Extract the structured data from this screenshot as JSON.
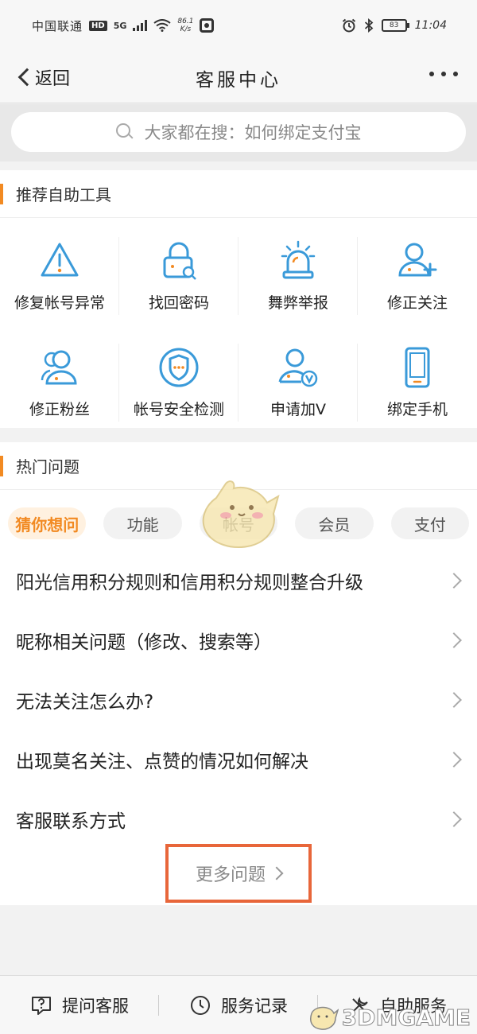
{
  "status_bar": {
    "carrier": "中国联通",
    "hd": "HD",
    "network": "5G",
    "speed_value": "86.1",
    "speed_unit": "K/s",
    "battery": "83",
    "time": "11:04"
  },
  "nav": {
    "back_label": "返回",
    "title": "客服中心"
  },
  "search": {
    "placeholder": "大家都在搜：如何绑定支付宝"
  },
  "colors": {
    "accent": "#f28a22",
    "icon_blue": "#3a9ad9",
    "highlight_box": "#e8663a"
  },
  "tools": {
    "title": "推荐自助工具",
    "items": [
      {
        "label": "修复帐号异常",
        "icon": "warning-icon"
      },
      {
        "label": "找回密码",
        "icon": "lock-search-icon"
      },
      {
        "label": "舞弊举报",
        "icon": "alarm-icon"
      },
      {
        "label": "修正关注",
        "icon": "user-add-icon"
      },
      {
        "label": "修正粉丝",
        "icon": "users-icon"
      },
      {
        "label": "帐号安全检测",
        "icon": "shield-icon"
      },
      {
        "label": "申请加V",
        "icon": "user-verified-icon"
      },
      {
        "label": "绑定手机",
        "icon": "phone-icon"
      }
    ]
  },
  "hot": {
    "title": "热门问题",
    "chips": [
      "猜你想问",
      "功能",
      "帐号",
      "会员",
      "支付"
    ],
    "questions": [
      "阳光信用积分规则和信用积分规则整合升级",
      "昵称相关问题（修改、搜索等）",
      "无法关注怎么办?",
      "出现莫名关注、点赞的情况如何解决",
      "客服联系方式"
    ],
    "more_label": "更多问题"
  },
  "bottom_bar": {
    "items": [
      {
        "label": "提问客服",
        "icon": "question-icon"
      },
      {
        "label": "服务记录",
        "icon": "clock-icon"
      },
      {
        "label": "自助服务",
        "icon": "tools-icon"
      }
    ]
  },
  "watermark": "3DMGAME"
}
